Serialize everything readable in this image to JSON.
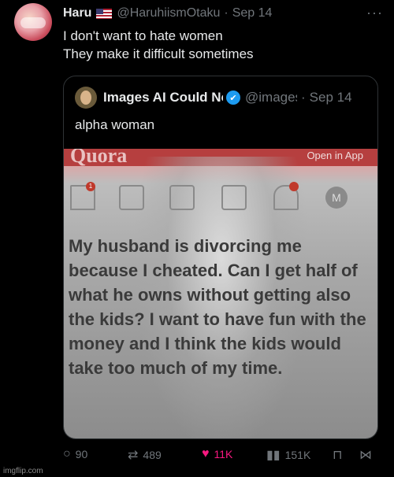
{
  "tweet": {
    "name": "Haru",
    "handle": "@HaruhiismOtaku",
    "date": "Sep 14",
    "more": "···",
    "text_line1": "I don't want to hate women",
    "text_line2": "They make it difficult sometimes"
  },
  "quote": {
    "name": "Images AI Could No",
    "handle": "@images",
    "date": "Sep 14",
    "text": "alpha woman",
    "image": {
      "app_logo": "Quora",
      "open_app": "Open in App",
      "notification_count": "1",
      "avatar_letter": "M",
      "body": "My husband is divorcing me because I cheated. Can I get half of what he owns without getting also the kids? I want to have fun with the money and I think the kids would take too much of my time."
    }
  },
  "actions": {
    "replies": "90",
    "reposts": "489",
    "likes": "11K",
    "views": "151K"
  },
  "watermark": "imgflip.com",
  "colors": {
    "like": "#f91880",
    "verified": "#1d9bf0",
    "muted": "#71767b"
  }
}
